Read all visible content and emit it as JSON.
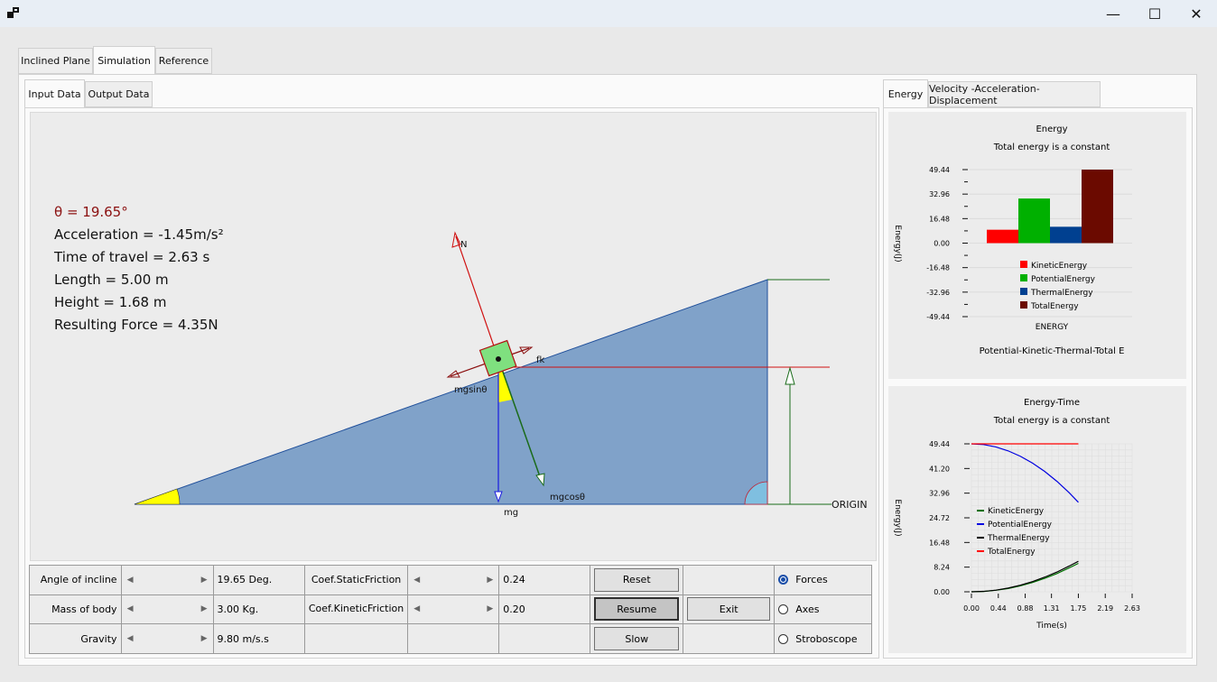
{
  "window": {
    "minimize": "—",
    "maximize": "☐",
    "close": "✕"
  },
  "main_tabs": [
    "Inclined Plane",
    "Simulation",
    "Reference"
  ],
  "sub_tabs": [
    "Input Data",
    "Output Data"
  ],
  "right_tabs": [
    "Energy",
    "Velocity -Acceleration-Displacement"
  ],
  "info": {
    "theta": "θ = 19.65°",
    "acceleration": "Acceleration = -1.45m/s²",
    "time": "Time of travel = 2.63 s",
    "length": "Length = 5.00 m",
    "height": "Height = 1.68 m",
    "force": "Resulting Force = 4.35N"
  },
  "diagram_labels": {
    "N": "N",
    "fk": "fk",
    "mgsin": "mgsinθ",
    "mgcos": "mgcosθ",
    "mg": "mg",
    "origin": "ORIGIN"
  },
  "controls": {
    "angle_label": "Angle of incline",
    "angle_value": "19.65 Deg.",
    "mass_label": "Mass of body",
    "mass_value": "3.00 Kg.",
    "gravity_label": "Gravity",
    "gravity_value": "9.80 m/s.s",
    "static_label": "Coef.StaticFriction",
    "static_value": "0.24",
    "kinetic_label": "Coef.KineticFriction",
    "kinetic_value": "0.20",
    "reset": "Reset",
    "resume": "Resume",
    "exit": "Exit",
    "slow": "Slow",
    "radio_forces": "Forces",
    "radio_axes": "Axes",
    "radio_strobe": "Stroboscope"
  },
  "chart_data": [
    {
      "type": "bar",
      "title": "Energy",
      "subtitle": "Total energy is a constant",
      "ylabel": "Energy(J)",
      "xlabel": "ENERGY",
      "footer": "Potential-Kinetic-Thermal-Total E",
      "ylim": [
        -49.44,
        49.44
      ],
      "yticks": [
        "49.44",
        "32.96",
        "16.48",
        "0.00",
        "-16.48",
        "-32.96",
        "-49.44"
      ],
      "series": [
        {
          "name": "KineticEnergy",
          "value": 9.0,
          "color": "#ff0000"
        },
        {
          "name": "PotentialEnergy",
          "value": 30.0,
          "color": "#00b000"
        },
        {
          "name": "ThermalEnergy",
          "value": 11.0,
          "color": "#004090"
        },
        {
          "name": "TotalEnergy",
          "value": 49.44,
          "color": "#6b0a00"
        }
      ]
    },
    {
      "type": "line",
      "title": "Energy-Time",
      "subtitle": "Total energy is a constant",
      "ylabel": "Energy(J)",
      "xlabel": "Time(s)",
      "xlim": [
        0,
        2.63
      ],
      "ylim": [
        0,
        49.44
      ],
      "xticks": [
        "0.00",
        "0.44",
        "0.88",
        "1.31",
        "1.75",
        "2.19",
        "2.63"
      ],
      "yticks": [
        "49.44",
        "41.20",
        "32.96",
        "24.72",
        "16.48",
        "8.24",
        "0.00"
      ],
      "x": [
        0,
        0.2,
        0.4,
        0.6,
        0.8,
        1.0,
        1.2,
        1.4,
        1.6,
        1.75
      ],
      "series": [
        {
          "name": "KineticEnergy",
          "color": "#007000",
          "values": [
            0,
            0.12,
            0.5,
            1.1,
            2.0,
            3.1,
            4.5,
            6.1,
            8.0,
            9.5
          ]
        },
        {
          "name": "PotentialEnergy",
          "color": "#0000e0",
          "values": [
            49.44,
            49.2,
            48.4,
            47.1,
            45.3,
            43.0,
            40.2,
            36.9,
            33.1,
            29.9
          ]
        },
        {
          "name": "ThermalEnergy",
          "color": "#000000",
          "values": [
            0,
            0.14,
            0.55,
            1.25,
            2.2,
            3.4,
            4.9,
            6.6,
            8.6,
            10.2
          ]
        },
        {
          "name": "TotalEnergy",
          "color": "#ff0000",
          "values": [
            49.44,
            49.44,
            49.44,
            49.44,
            49.44,
            49.44,
            49.44,
            49.44,
            49.44,
            49.44
          ]
        }
      ]
    }
  ]
}
